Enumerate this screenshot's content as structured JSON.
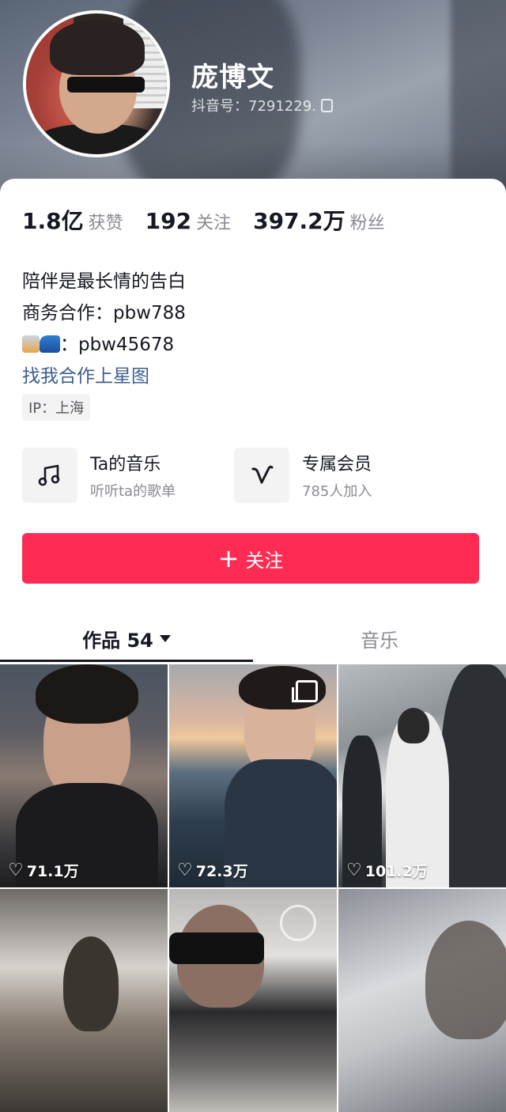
{
  "profile": {
    "name": "庞博文",
    "douyin_id": "抖音号：7291229."
  },
  "stats": [
    {
      "value": "1.8亿",
      "label": "获赞"
    },
    {
      "value": "192",
      "label": "关注"
    },
    {
      "value": "397.2万",
      "label": "粉丝"
    }
  ],
  "bio": {
    "line1": "陪伴是最长情的告白",
    "line2": "商务合作：pbw788",
    "line3": "：pbw45678",
    "link": "找我合作上星图",
    "ip": "IP：上海"
  },
  "features": [
    {
      "title": "Ta的音乐",
      "subtitle": "听听ta的歌单",
      "icon": "music-note-icon"
    },
    {
      "title": "专属会员",
      "subtitle": "785人加入",
      "icon": "v-logo-icon"
    }
  ],
  "follow_button": {
    "label": "关注"
  },
  "tabs": [
    {
      "label": "作品 54",
      "active": true
    },
    {
      "label": "音乐",
      "active": false
    }
  ],
  "videos": [
    {
      "likes": "71.1万"
    },
    {
      "likes": "72.3万",
      "multi": true
    },
    {
      "likes": "101.2万"
    },
    {
      "likes": ""
    },
    {
      "likes": ""
    },
    {
      "likes": ""
    }
  ],
  "colors": {
    "accent": "#fe2c55",
    "link": "#3c5e8c",
    "text": "#161823",
    "muted": "#8a8b91"
  }
}
